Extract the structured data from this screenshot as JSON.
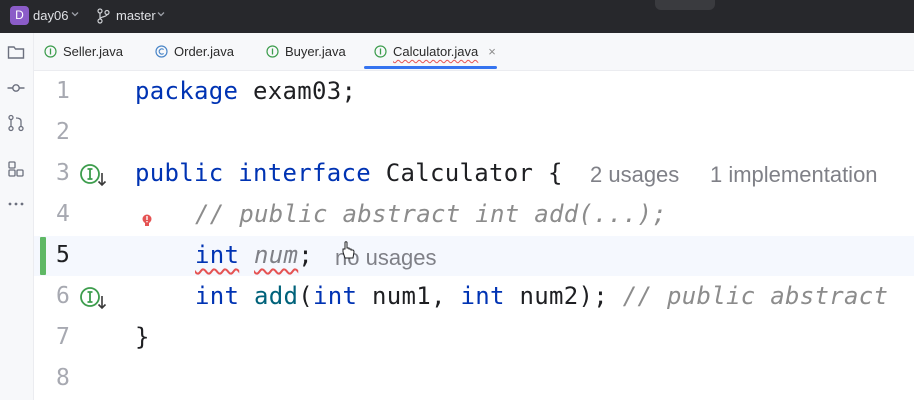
{
  "titlebar": {
    "project_badge": "D",
    "project_name": "day06",
    "branch": "master"
  },
  "tabs": [
    {
      "label": "Seller.java",
      "icon": "interface-icon"
    },
    {
      "label": "Order.java",
      "icon": "class-icon"
    },
    {
      "label": "Buyer.java",
      "icon": "interface-icon"
    },
    {
      "label": "Calculator.java",
      "icon": "interface-icon",
      "active": true,
      "close": "×"
    }
  ],
  "line_numbers": [
    "1",
    "2",
    "3",
    "4",
    "5",
    "6",
    "7",
    "8"
  ],
  "code": {
    "l1_kw": "package",
    "l1_rest": " exam03;",
    "l3_kw1": "public",
    "l3_kw2": "interface",
    "l3_rest": " Calculator {",
    "l3_hint_usages": "2 usages",
    "l3_hint_impl": "1 implementation",
    "l4_comment": "// public abstract int add(...);",
    "l5_kw": "int",
    "l5_field": "num",
    "l5_semicolon": ";",
    "l5_hint": "no usages",
    "l6_kw1": "int",
    "l6_method": "add",
    "l6_p1": "(",
    "l6_kw2": "int",
    "l6_p2": " num1, ",
    "l6_kw3": "int",
    "l6_p3": " num2); ",
    "l6_comment": "// public abstract",
    "l7_brace": "}"
  },
  "colors": {
    "keyword": "#0033b3",
    "comment": "#8c8c8c",
    "accent": "#3574f0",
    "change_marker": "#5fb865",
    "badge": "#8b5cc8"
  }
}
